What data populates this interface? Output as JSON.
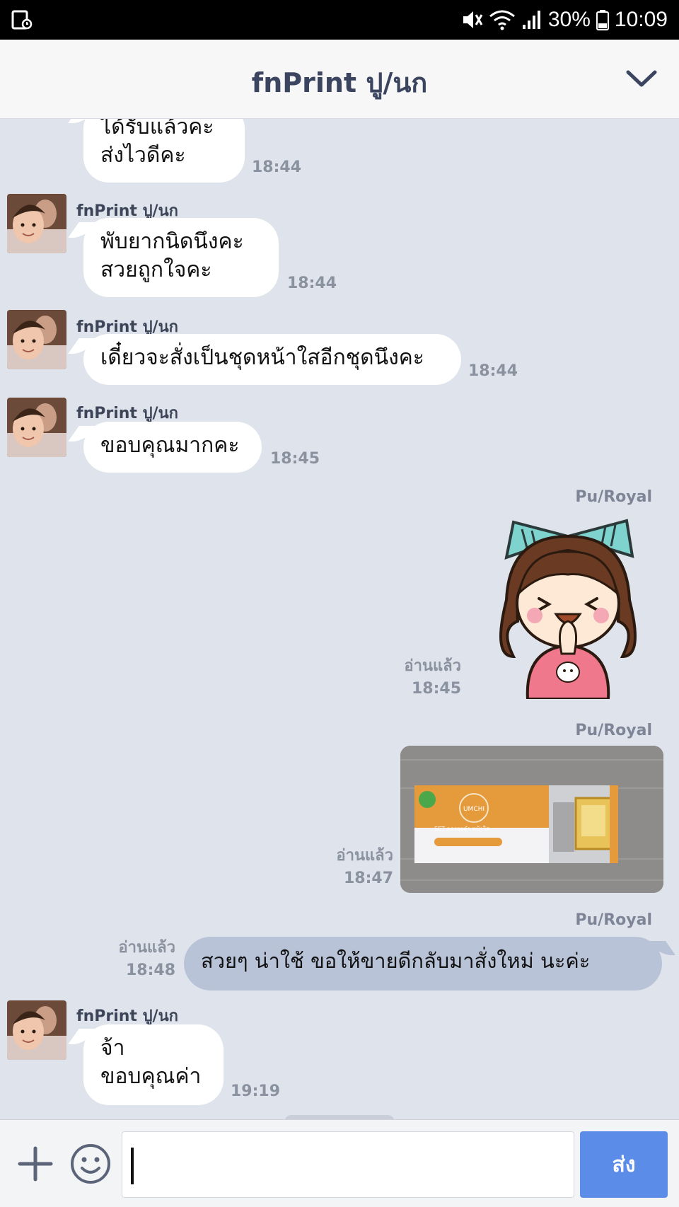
{
  "statusbar": {
    "battery": "30%",
    "time": "10:09"
  },
  "header": {
    "title": "fnPrint ปู/นก"
  },
  "messages": [
    {
      "text": "ได้รับแล้วคะ\nส่งไวดีคะ",
      "time": "18:44"
    },
    {
      "sender": "fnPrint ปู/นก",
      "text": "พับยากนิดนึงคะ\nสวยถูกใจคะ",
      "time": "18:44"
    },
    {
      "sender": "fnPrint ปู/นก",
      "text": "เดี๋ยวจะสั่งเป็นชุดหน้าใสอีกชุดนึงคะ",
      "time": "18:44"
    },
    {
      "sender": "fnPrint ปู/นก",
      "text": "ขอบคุณมากคะ",
      "time": "18:45"
    },
    {
      "sender": "Pu/Royal",
      "read": "อ่านแล้ว",
      "time": "18:45"
    },
    {
      "sender": "Pu/Royal",
      "read": "อ่านแล้ว",
      "time": "18:47",
      "product_brand": "UMCHI",
      "product_line": "SET ลดรอยดำ หน้าใส"
    },
    {
      "sender": "Pu/Royal",
      "read": "อ่านแล้ว",
      "time": "18:48",
      "text": "สวยๆ  น่าใช้  ขอให้ขายดีกลับมาสั่งใหม่  นะค่ะ"
    },
    {
      "sender": "fnPrint ปู/นก",
      "text": "จ้า\nขอบคุณค่า",
      "time": "19:19"
    }
  ],
  "input": {
    "value": "",
    "send_label": "ส่ง"
  },
  "colors": {
    "chat_bg": "#dfe4ec",
    "incoming": "#ffffff",
    "outgoing": "#b9c3d8",
    "send": "#5b8de8"
  }
}
